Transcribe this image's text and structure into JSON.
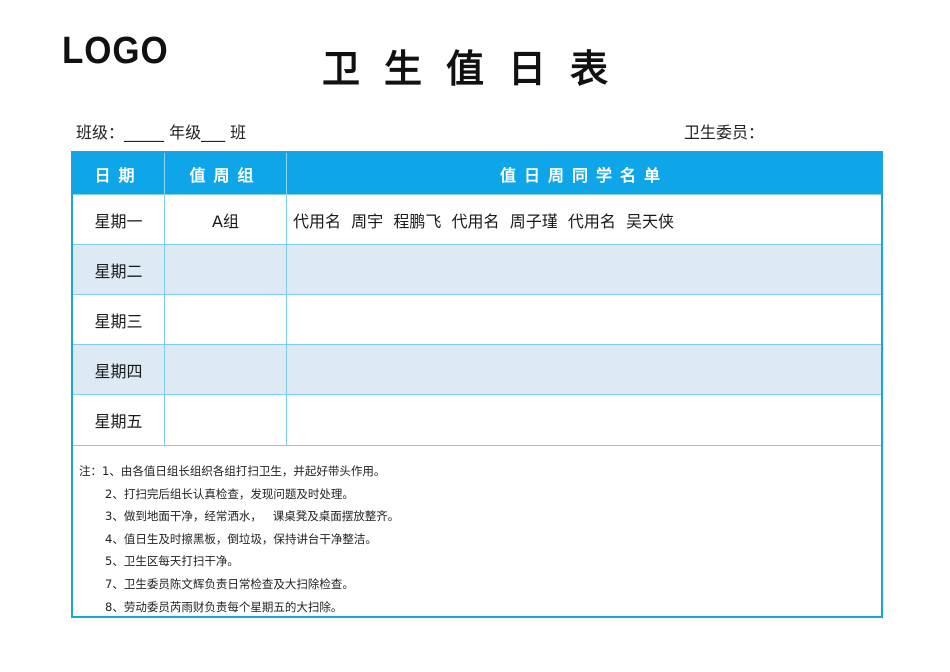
{
  "logo": "LOGO",
  "title": "卫生值日表",
  "meta": {
    "class_line": "班级：_____ 年级___ 班",
    "committee_label": "卫生委员："
  },
  "table": {
    "headers": [
      "日期",
      "值周组",
      "值日周同学名单"
    ],
    "rows": [
      {
        "day": "星期一",
        "group": "A组",
        "names": "代用名  周宇  程鹏飞  代用名  周子瑾  代用名  吴天侠"
      },
      {
        "day": "星期二",
        "group": "",
        "names": ""
      },
      {
        "day": "星期三",
        "group": "",
        "names": ""
      },
      {
        "day": "星期四",
        "group": "",
        "names": ""
      },
      {
        "day": "星期五",
        "group": "",
        "names": ""
      }
    ]
  },
  "notes": {
    "prefix": "注：",
    "items": [
      "1、由各值日组长组织各组打扫卫生，并起好带头作用。",
      "2、打扫完后组长认真检查，发现问题及时处理。",
      "3、做到地面干净，经常洒水，   课桌凳及桌面摆放整齐。",
      "4、值日生及时擦黑板，倒垃圾，保持讲台干净整洁。",
      "5、卫生区每天打扫干净。",
      "7、卫生委员陈文辉负责日常检查及大扫除检查。",
      "8、劳动委员芮雨财负责每个星期五的大扫除。"
    ]
  },
  "colors": {
    "header_bg": "#0ea6e8",
    "border": "#1aa4e3",
    "shade_row": "#dde9f5"
  }
}
